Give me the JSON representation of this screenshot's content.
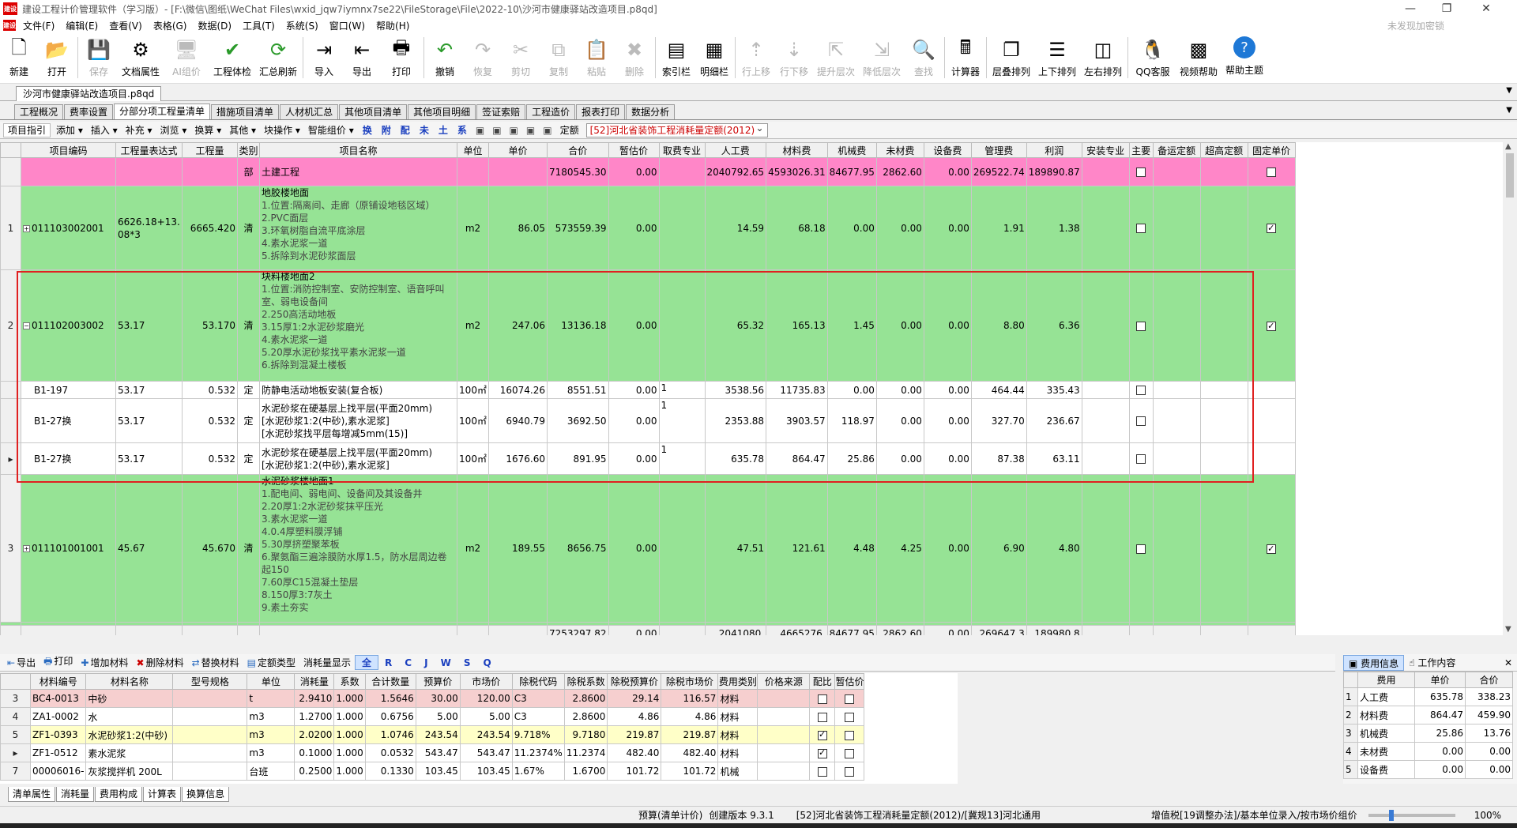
{
  "window": {
    "app_name": "建设工程计价管理软件（学习版）",
    "path": " - [F:\\微信\\图纸\\WeChat Files\\wxid_jqw7iymnx7se22\\FileStorage\\File\\2022-10\\沙河市健康驿站改造项目.p8qd]",
    "logo": "建设"
  },
  "menu": [
    "文件(F)",
    "编辑(E)",
    "查看(V)",
    "表格(G)",
    "数据(D)",
    "工具(T)",
    "系统(S)",
    "窗口(W)",
    "帮助(H)"
  ],
  "menu_right": "未发现加密锁",
  "toolbar": [
    {
      "label": "新建",
      "icon": "new-file-icon",
      "glyph": "🗋",
      "enabled": true
    },
    {
      "label": "打开",
      "icon": "open-folder-icon",
      "glyph": "📂",
      "enabled": true
    },
    {
      "label": "保存",
      "icon": "save-icon",
      "glyph": "💾",
      "enabled": false
    },
    {
      "label": "文档属性",
      "icon": "gear-icon",
      "glyph": "⚙",
      "enabled": true
    },
    {
      "label": "AI组价",
      "icon": "ai-icon",
      "glyph": "🖥",
      "enabled": false
    },
    {
      "label": "工程体检",
      "icon": "check-icon",
      "glyph": "✔",
      "enabled": true
    },
    {
      "label": "汇总刷新",
      "icon": "refresh-icon",
      "glyph": "⟳",
      "enabled": true
    },
    {
      "label": "导入",
      "icon": "import-icon",
      "glyph": "⇥",
      "enabled": true
    },
    {
      "label": "导出",
      "icon": "export-icon",
      "glyph": "⇤",
      "enabled": true
    },
    {
      "label": "打印",
      "icon": "printer-icon",
      "glyph": "🖶",
      "enabled": true
    },
    {
      "label": "撤销",
      "icon": "undo-icon",
      "glyph": "↶",
      "enabled": true
    },
    {
      "label": "恢复",
      "icon": "redo-icon",
      "glyph": "↷",
      "enabled": false
    },
    {
      "label": "剪切",
      "icon": "cut-icon",
      "glyph": "✂",
      "enabled": false
    },
    {
      "label": "复制",
      "icon": "copy-icon",
      "glyph": "⧉",
      "enabled": false
    },
    {
      "label": "粘贴",
      "icon": "paste-icon",
      "glyph": "📋",
      "enabled": false
    },
    {
      "label": "删除",
      "icon": "delete-icon",
      "glyph": "✖",
      "enabled": false
    },
    {
      "label": "索引栏",
      "icon": "index-bar-icon",
      "glyph": "▤",
      "enabled": true
    },
    {
      "label": "明细栏",
      "icon": "detail-bar-icon",
      "glyph": "▦",
      "enabled": true
    },
    {
      "label": "行上移",
      "icon": "move-up-icon",
      "glyph": "⇡",
      "enabled": false
    },
    {
      "label": "行下移",
      "icon": "move-down-icon",
      "glyph": "⇣",
      "enabled": false
    },
    {
      "label": "提升层次",
      "icon": "promote-icon",
      "glyph": "⇱",
      "enabled": false
    },
    {
      "label": "降低层次",
      "icon": "demote-icon",
      "glyph": "⇲",
      "enabled": false
    },
    {
      "label": "查找",
      "icon": "find-icon",
      "glyph": "🔍",
      "enabled": false
    },
    {
      "label": "计算器",
      "icon": "calculator-icon",
      "glyph": "🖩",
      "enabled": true
    },
    {
      "label": "层叠排列",
      "icon": "cascade-icon",
      "glyph": "❐",
      "enabled": true
    },
    {
      "label": "上下排列",
      "icon": "tile-horizontal-icon",
      "glyph": "☰",
      "enabled": true
    },
    {
      "label": "左右排列",
      "icon": "tile-vertical-icon",
      "glyph": "◫",
      "enabled": true
    },
    {
      "label": "QQ客服",
      "icon": "qq-icon",
      "glyph": "🐧",
      "enabled": true
    },
    {
      "label": "视频帮助",
      "icon": "qr-code-icon",
      "glyph": "▩",
      "enabled": true
    },
    {
      "label": "帮助主题",
      "icon": "help-icon",
      "glyph": "?",
      "enabled": true
    }
  ],
  "doc_tab": "沙河市健康驿站改造项目.p8qd",
  "func_tabs": [
    "工程概况",
    "费率设置",
    "分部分项工程量清单",
    "措施项目清单",
    "人材机汇总",
    "其他项目清单",
    "其他项目明细",
    "签证索赔",
    "工程造价",
    "报表打印",
    "数据分析"
  ],
  "func_tab_active": 2,
  "subbar": {
    "buttons": [
      "项目指引",
      "添加 ▾",
      "插入 ▾",
      "补充 ▾",
      "浏览 ▾",
      "换算 ▾",
      "其他 ▾",
      "块操作 ▾",
      "智能组价 ▾"
    ],
    "quick": [
      "换",
      "附",
      "配",
      "未",
      "土",
      "系"
    ],
    "ding_label": "定额",
    "ding_value": "[52]河北省装饰工程消耗量定额(2012)"
  },
  "main_headers": [
    "",
    "项目编码",
    "工程量表达式",
    "工程量",
    "类别",
    "项目名称",
    "单位",
    "单价",
    "合价",
    "暂估价",
    "取费专业",
    "人工费",
    "材料费",
    "机械费",
    "未材费",
    "设备费",
    "管理费",
    "利润",
    "安装专业",
    "主要",
    "备运定额",
    "超高定额",
    "固定单价"
  ],
  "main_rows": [
    {
      "style": "pink",
      "rowno": "",
      "code": "",
      "expr": "",
      "qty": "",
      "kind": "部",
      "name": "土建工程",
      "unit": "",
      "price": "",
      "total": "7180545.30",
      "est": "0.00",
      "spec": "",
      "labor": "2040792.65",
      "mat": "4593026.31",
      "mach": "84677.95",
      "wc": "2862.60",
      "equip": "0.00",
      "mgmt": "269522.74",
      "profit": "189890.87",
      "main_cb": false,
      "fix_cb": false,
      "h": 36
    },
    {
      "style": "green",
      "rowno": "1",
      "code": "011103002001",
      "expr": "6626.18+13.08*3",
      "qty": "6665.420",
      "kind": "清",
      "name": "地胶楼地面",
      "desc": "1.位置:隔离间、走廊（原铺设地毯区域）\n2.PVC面层\n3.环氧树脂自流平底涂层\n4.素水泥浆一道\n5.拆除到水泥砂浆面层",
      "unit": "m2",
      "price": "86.05",
      "total": "573559.39",
      "est": "0.00",
      "spec": "",
      "labor": "14.59",
      "mat": "68.18",
      "mach": "0.00",
      "wc": "0.00",
      "equip": "0.00",
      "mgmt": "1.91",
      "profit": "1.38",
      "main_cb": false,
      "fix_cb": true,
      "h": 106
    },
    {
      "style": "green",
      "rowno": "2",
      "code": "011102003002",
      "expr": "53.17",
      "qty": "53.170",
      "kind": "清",
      "name": "块料楼地面2",
      "desc": "1.位置:消防控制室、安防控制室、语音呼叫室、弱电设备间\n2.250高活动地板\n3.15厚1:2水泥砂浆磨光\n4.素水泥浆一道\n5.20厚水泥砂浆找平素水泥浆一道\n6.拆除到混凝土楼板",
      "unit": "m2",
      "price": "247.06",
      "total": "13136.18",
      "est": "0.00",
      "spec": "",
      "labor": "65.32",
      "mat": "165.13",
      "mach": "1.45",
      "wc": "0.00",
      "equip": "0.00",
      "mgmt": "8.80",
      "profit": "6.36",
      "main_cb": false,
      "fix_cb": true,
      "h": 141
    },
    {
      "style": "white",
      "rowno": "",
      "code": "B1-197",
      "expr": "53.17",
      "qty": "0.532",
      "kind": "定",
      "name": "防静电活动地板安装(复合板)",
      "unit": "100㎡",
      "price": "16074.26",
      "total": "8551.51",
      "est": "0.00",
      "spec": "1",
      "labor": "3538.56",
      "mat": "11735.83",
      "mach": "0.00",
      "wc": "0.00",
      "equip": "0.00",
      "mgmt": "464.44",
      "profit": "335.43",
      "main_cb": false,
      "fix_cb": null,
      "h": 22
    },
    {
      "style": "white",
      "rowno": "",
      "code": "B1-27换",
      "expr": "53.17",
      "qty": "0.532",
      "kind": "定",
      "name": "水泥砂浆在硬基层上找平层(平面20mm)\n[水泥砂浆1:2(中砂),素水泥浆]\n[水泥砂浆找平层每增减5mm(15)]",
      "unit": "100㎡",
      "price": "6940.79",
      "total": "3692.50",
      "est": "0.00",
      "spec": "1",
      "labor": "2353.88",
      "mat": "3903.57",
      "mach": "118.97",
      "wc": "0.00",
      "equip": "0.00",
      "mgmt": "327.70",
      "profit": "236.67",
      "main_cb": false,
      "fix_cb": null,
      "h": 56
    },
    {
      "style": "white",
      "rowno": "▸",
      "code": "B1-27换",
      "expr": "53.17",
      "qty": "0.532",
      "kind": "定",
      "name": "水泥砂浆在硬基层上找平层(平面20mm)\n[水泥砂浆1:2(中砂),素水泥浆]",
      "unit": "100㎡",
      "price": "1676.60",
      "total": "891.95",
      "est": "0.00",
      "spec": "1",
      "labor": "635.78",
      "mat": "864.47",
      "mach": "25.86",
      "wc": "0.00",
      "equip": "0.00",
      "mgmt": "87.38",
      "profit": "63.11",
      "main_cb": false,
      "fix_cb": null,
      "h": 40
    },
    {
      "style": "green",
      "rowno": "3",
      "code": "011101001001",
      "expr": "45.67",
      "qty": "45.670",
      "kind": "清",
      "name": "水泥砂浆楼地面1",
      "desc": "1.配电间、弱电间、设备间及其设备井\n2.20厚1:2水泥砂浆抹平压光\n3.素水泥浆一道\n4.0.4厚塑料膜浮铺\n5.30厚挤塑聚苯板\n6.聚氨酯三遍涂膜防水厚1.5，防水层周边卷起150\n7.60厚C15混凝土垫层\n8.150厚3:7灰土\n9.素土夯实",
      "unit": "m2",
      "price": "189.55",
      "total": "8656.75",
      "est": "0.00",
      "spec": "",
      "labor": "47.51",
      "mat": "121.61",
      "mach": "4.48",
      "wc": "4.25",
      "equip": "0.00",
      "mgmt": "6.90",
      "profit": "4.80",
      "main_cb": false,
      "fix_cb": true,
      "h": 187
    }
  ],
  "main_total": {
    "total": "7253297.82",
    "est": "0.00",
    "labor": "2041080.",
    "mat": "4665276.",
    "mach": "84677.95",
    "wc": "2862.60",
    "equip": "0.00",
    "mgmt": "269647.3",
    "profit": "189980.8"
  },
  "lowbar": {
    "buttons": [
      "导出",
      "打印",
      "增加材料",
      "删除材料",
      "替换材料",
      "定额类型"
    ],
    "label": "消耗量显示",
    "filters": [
      "全",
      "R",
      "C",
      "J",
      "W",
      "S",
      "Q"
    ]
  },
  "low_headers": [
    "",
    "材料编号",
    "材料名称",
    "型号规格",
    "单位",
    "消耗量",
    "系数",
    "合计数量",
    "预算价",
    "市场价",
    "除税代码",
    "除税系数",
    "除税预算价",
    "除税市场价",
    "费用类别",
    "价格来源",
    "配比",
    "暂估价"
  ],
  "low_rows": [
    {
      "style": "lpink",
      "no": "3",
      "code": "BC4-0013",
      "name": "中砂",
      "spec": "",
      "unit": "t",
      "cons": "2.9410",
      "coef": "1.000",
      "sum": "1.5646",
      "bp": "30.00",
      "mp": "120.00",
      "tc": "C3",
      "tcoef": "2.8600",
      "tbp": "29.14",
      "tmp": "116.57",
      "cat": "材料",
      "src": "",
      "ratio": false,
      "est": false
    },
    {
      "style": "lplain",
      "no": "4",
      "code": "ZA1-0002",
      "name": "水",
      "spec": "",
      "unit": "m3",
      "cons": "1.2700",
      "coef": "1.000",
      "sum": "0.6756",
      "bp": "5.00",
      "mp": "5.00",
      "tc": "C3",
      "tcoef": "2.8600",
      "tbp": "4.86",
      "tmp": "4.86",
      "cat": "材料",
      "src": "",
      "ratio": false,
      "est": false
    },
    {
      "style": "lyellow",
      "no": "5",
      "code": "ZF1-0393",
      "name": "水泥砂浆1:2(中砂)",
      "spec": "",
      "unit": "m3",
      "cons": "2.0200",
      "coef": "1.000",
      "sum": "1.0746",
      "bp": "243.54",
      "mp": "243.54",
      "tc": "9.718%",
      "tcoef": "9.7180",
      "tbp": "219.87",
      "tmp": "219.87",
      "cat": "材料",
      "src": "",
      "ratio": true,
      "est": false
    },
    {
      "style": "lplain",
      "no": "▸",
      "code": "ZF1-0512",
      "name": "素水泥浆",
      "spec": "",
      "unit": "m3",
      "cons": "0.1000",
      "coef": "1.000",
      "sum": "0.0532",
      "bp": "543.47",
      "mp": "543.47",
      "tc": "11.2374%",
      "tcoef": "11.2374",
      "tbp": "482.40",
      "tmp": "482.40",
      "cat": "材料",
      "src": "",
      "ratio": true,
      "est": false
    },
    {
      "style": "lplain",
      "no": "7",
      "code": "00006016-",
      "name": "灰浆搅拌机 200L",
      "spec": "",
      "unit": "台班",
      "cons": "0.2500",
      "coef": "1.000",
      "sum": "0.1330",
      "bp": "103.45",
      "mp": "103.45",
      "tc": "1.67%",
      "tcoef": "1.6700",
      "tbp": "101.72",
      "tmp": "101.72",
      "cat": "机械",
      "src": "",
      "ratio": false,
      "est": false
    }
  ],
  "right_panel": {
    "tabs": [
      "费用信息",
      "工作内容"
    ],
    "headers": [
      "",
      "费用",
      "单价",
      "合价"
    ],
    "rows": [
      {
        "no": "1",
        "name": "人工费",
        "price": "635.78",
        "total": "338.23"
      },
      {
        "no": "2",
        "name": "材料费",
        "price": "864.47",
        "total": "459.90"
      },
      {
        "no": "3",
        "name": "机械费",
        "price": "25.86",
        "total": "13.76"
      },
      {
        "no": "4",
        "name": "未材费",
        "price": "0.00",
        "total": "0.00"
      },
      {
        "no": "5",
        "name": "设备费",
        "price": "0.00",
        "total": "0.00"
      }
    ]
  },
  "bottom_tabs": [
    "清单属性",
    "消耗量",
    "费用构成",
    "计算表",
    "换算信息"
  ],
  "status": {
    "mode": "预算(清单计价)",
    "version": "创建版本 9.3.1",
    "ding": "[52]河北省装饰工程消耗量定额(2012)/[冀规13]河北通用",
    "tax": "增值税[19调整办法]/基本单位录入/按市场价组价",
    "zoom": "100%"
  },
  "colors": {
    "pink_row": "#ff86c8",
    "green_row": "#96e395",
    "highlight_box": "#e02020",
    "ding_text": "#cc0000"
  }
}
